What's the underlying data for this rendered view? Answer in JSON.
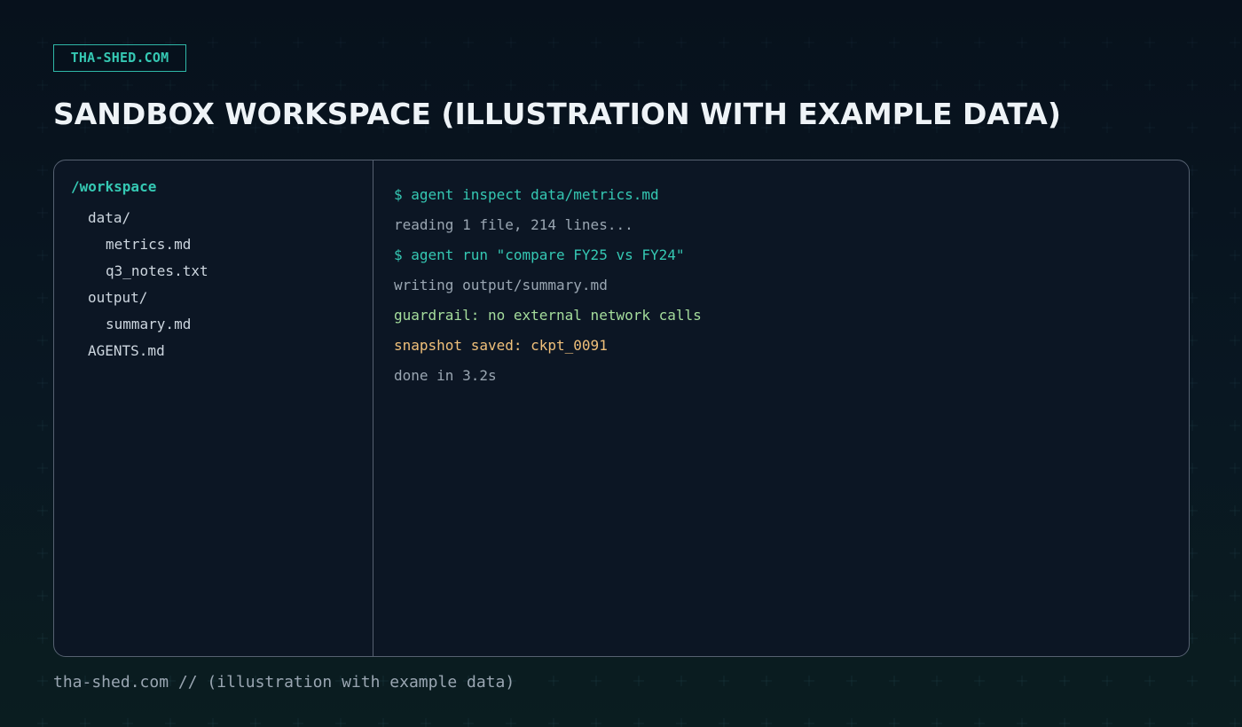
{
  "brand": {
    "badge_label": "THA-SHED.COM"
  },
  "header": {
    "title": "SANDBOX WORKSPACE (ILLUSTRATION WITH EXAMPLE DATA)"
  },
  "file_tree": {
    "root": "/workspace",
    "items": [
      "data/",
      "metrics.md",
      "q3_notes.txt",
      "output/",
      "summary.md",
      "AGENTS.md"
    ]
  },
  "terminal": {
    "lines": [
      "$ agent inspect data/metrics.md",
      "reading 1 file, 214 lines...",
      "$ agent run \"compare FY25 vs FY24\"",
      "writing output/summary.md",
      "guardrail: no external network calls",
      "snapshot saved: ckpt_0091",
      "done in 3.2s"
    ]
  },
  "footer": {
    "text": "tha-shed.com // (illustration with example data)"
  },
  "colors": {
    "accent_teal": "#35c8b3",
    "muted_text": "#9aa6b2",
    "success_green": "#a5dd9c",
    "warning_amber": "#f0c07a",
    "panel_border": "#566171",
    "panel_background": "#0c1624"
  }
}
